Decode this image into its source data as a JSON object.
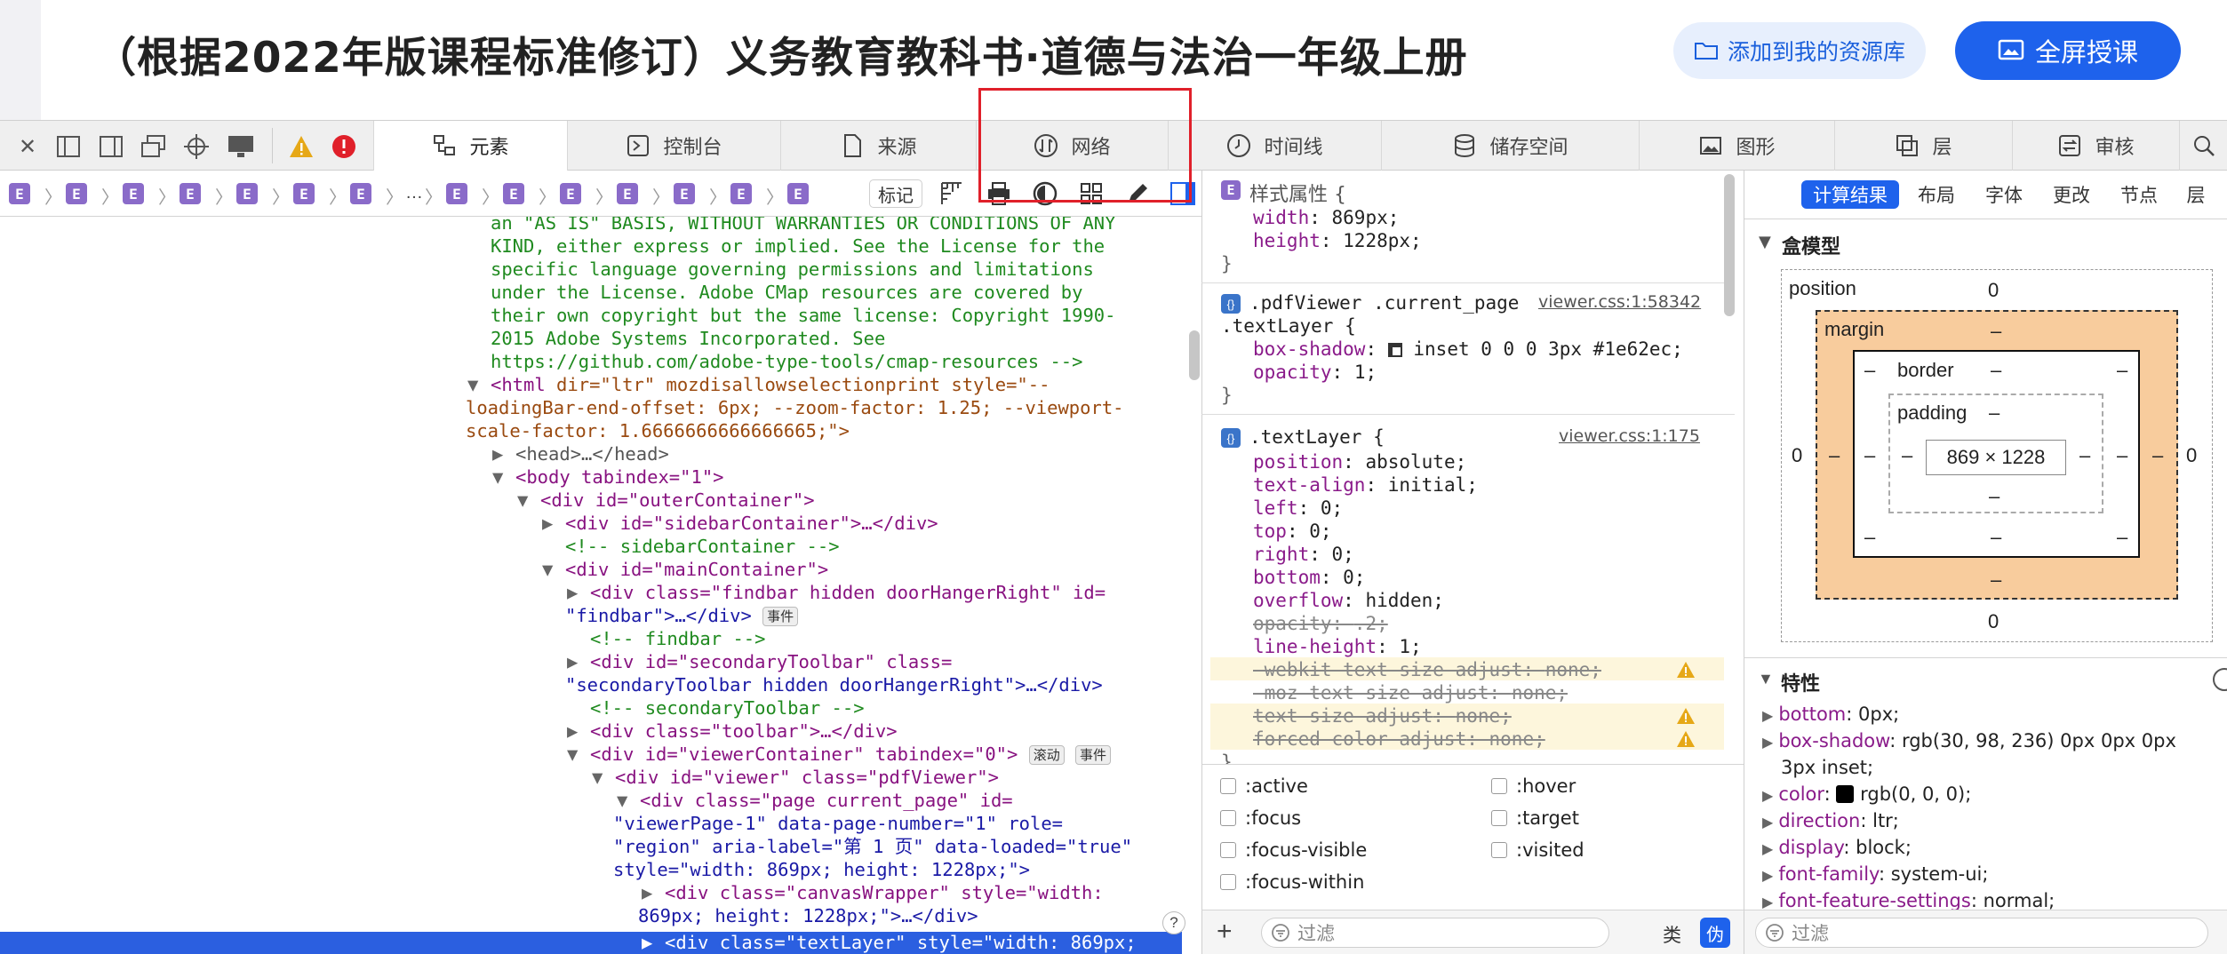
{
  "page": {
    "title": "（根据2022年版课程标准修订）义务教育教科书·道德与法治一年级上册",
    "add_resource_label": "添加到我的资源库",
    "fullscreen_label": "全屏授课"
  },
  "devtools": {
    "tabs": [
      {
        "label": "元素",
        "icon": "elements-icon"
      },
      {
        "label": "控制台",
        "icon": "console-icon"
      },
      {
        "label": "来源",
        "icon": "sources-icon"
      },
      {
        "label": "网络",
        "icon": "network-icon"
      },
      {
        "label": "时间线",
        "icon": "timeline-icon"
      },
      {
        "label": "储存空间",
        "icon": "storage-icon"
      },
      {
        "label": "图形",
        "icon": "graphics-icon"
      },
      {
        "label": "层",
        "icon": "layers-icon"
      },
      {
        "label": "审核",
        "icon": "audit-icon"
      }
    ],
    "breadcrumb_item": "E",
    "breadcrumb_ellipsis": "…",
    "mark_label": "标记",
    "dom_lines": {
      "l0": "an \"AS IS\" BASIS, WITHOUT WARRANTIES OR CONDITIONS OF ANY",
      "l1": "KIND, either express or implied. See the License for the",
      "l2": "specific language governing permissions and limitations",
      "l3": "under the License. Adobe CMap resources are covered by",
      "l4": "their own copyright but the same license: Copyright 1990-",
      "l5": "2015 Adobe Systems Incorporated. See",
      "l6": "https://github.com/adobe-type-tools/cmap-resources -->",
      "html_open": "<html",
      "html_attrs": " dir=\"ltr\" mozdisallowselectionprint style=\"--",
      "html_l2": "loadingBar-end-offset: 6px; --zoom-factor: 1.25; --viewport-",
      "html_l3": "scale-factor: 1.6666666666666665;\">",
      "head": "<head>…</head>",
      "body": "<body tabindex=\"1\">",
      "outer": "<div id=\"outerContainer\">",
      "sidebar": "<div id=\"sidebarContainer\">…</div>",
      "sidebar_cmt": "<!-- sidebarContainer -->",
      "main": "<div id=\"mainContainer\">",
      "findbar1": "<div class=\"findbar hidden doorHangerRight\" id=",
      "findbar2": "\"findbar\">…</div>",
      "findbar_cmt": "<!-- findbar -->",
      "sec1": "<div id=\"secondaryToolbar\" class=",
      "sec2": "\"secondaryToolbar hidden doorHangerRight\">…</div>",
      "sec_cmt": "<!-- secondaryToolbar -->",
      "toolbar": "<div class=\"toolbar\">…</div>",
      "viewerc": "<div id=\"viewerContainer\" tabindex=\"0\">",
      "viewer": "<div id=\"viewer\" class=\"pdfViewer\">",
      "page1": "<div class=\"page current_page\" id=",
      "page2": "\"viewerPage-1\" data-page-number=\"1\" role=",
      "page3": "\"region\" aria-label=\"第 1 页\" data-loaded=\"true\"",
      "page4": "style=\"width: 869px; height: 1228px;\">",
      "canvas1": "<div class=\"canvasWrapper\" style=\"width:",
      "canvas2": "869px; height: 1228px;\">…</div>",
      "textlayer": "<div class=\"textLayer\" style=\"width: 869px;",
      "badge_event": "事件",
      "badge_scroll": "滚动"
    }
  },
  "styles": {
    "inline_header": "样式属性 {",
    "r1": [
      {
        "p": "width",
        "v": "869px;"
      },
      {
        "p": "height",
        "v": "1228px;"
      }
    ],
    "sel2a": ".pdfViewer .current_page",
    "sel2b": ".textLayer {",
    "src2": "viewer.css:1:58342",
    "r2": [
      {
        "p": "box-shadow",
        "v": "inset 0 0 0 3px #1e62ec;"
      },
      {
        "p": "opacity",
        "v": "1;"
      }
    ],
    "sel3": ".textLayer {",
    "src3": "viewer.css:1:175",
    "r3": [
      {
        "p": "position",
        "v": "absolute;"
      },
      {
        "p": "text-align",
        "v": "initial;"
      },
      {
        "p": "left",
        "v": "0;"
      },
      {
        "p": "top",
        "v": "0;"
      },
      {
        "p": "right",
        "v": "0;"
      },
      {
        "p": "bottom",
        "v": "0;"
      },
      {
        "p": "overflow",
        "v": "hidden;"
      },
      {
        "p": "opacity",
        "v": ".2;"
      },
      {
        "p": "line-height",
        "v": "1;"
      },
      {
        "p": "-webkit-text-size-adjust",
        "v": "none;"
      },
      {
        "p": "-moz-text-size-adjust",
        "v": "none;"
      },
      {
        "p": "text-size-adjust",
        "v": "none;"
      },
      {
        "p": "forced-color-adjust",
        "v": "none;"
      }
    ],
    "close": "}",
    "pseudo": [
      ":active",
      ":hover",
      ":focus",
      ":target",
      ":focus-visible",
      ":visited",
      ":focus-within"
    ],
    "filter_placeholder": "过滤",
    "class_label": "类",
    "pseudo_label": "伪"
  },
  "computed": {
    "tabs": [
      "计算结果",
      "布局",
      "字体",
      "更改",
      "节点",
      "层"
    ],
    "boxmodel_title": "盒模型",
    "position_label": "position",
    "margin_label": "margin",
    "border_label": "border",
    "padding_label": "padding",
    "dash": "–",
    "zero": "0",
    "content_size": "869 × 1228",
    "props_title": "特性",
    "props": [
      {
        "k": "bottom",
        "v": "0px;"
      },
      {
        "k": "box-shadow",
        "v": "rgb(30, 98, 236) 0px 0px 0px"
      },
      {
        "k": "",
        "v": "3px inset;"
      },
      {
        "k": "color",
        "v": "rgb(0, 0, 0);"
      },
      {
        "k": "direction",
        "v": "ltr;"
      },
      {
        "k": "display",
        "v": "block;"
      },
      {
        "k": "font-family",
        "v": "system-ui;"
      },
      {
        "k": "font-feature-settings",
        "v": "normal;"
      }
    ],
    "filter_placeholder": "过滤"
  },
  "colors": {
    "accent": "#1e62ec",
    "highlight_red": "#e0202a"
  }
}
